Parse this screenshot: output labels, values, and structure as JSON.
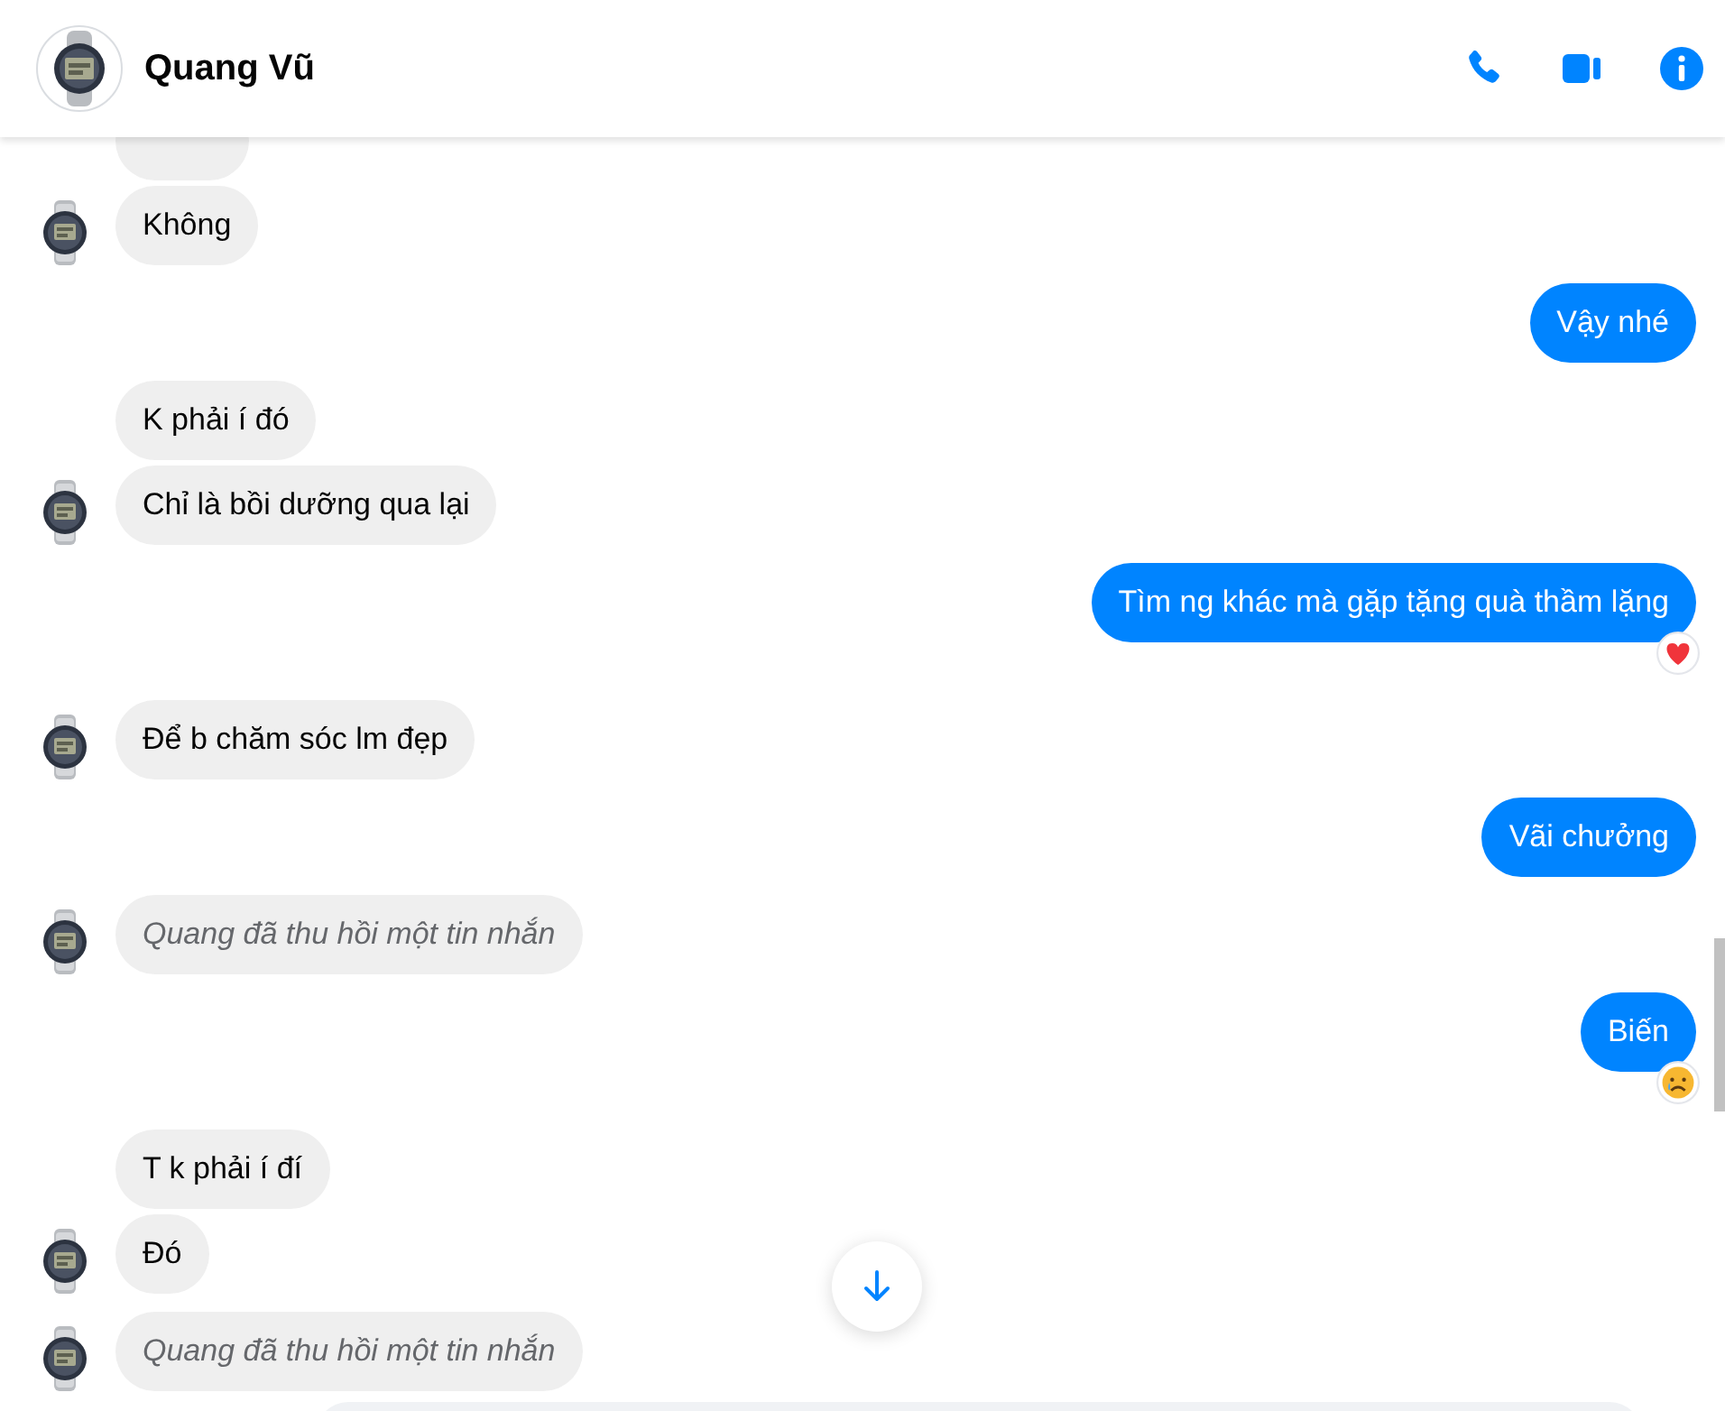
{
  "header": {
    "name": "Quang Vũ"
  },
  "messages": [
    {
      "kind": "incoming",
      "avatar": false
    },
    {
      "kind": "incoming",
      "unsent": false,
      "text": "Không",
      "avatar": true
    },
    {
      "kind": "outgoing",
      "text": "Vậy nhé"
    },
    {
      "kind": "incoming",
      "unsent": false,
      "text": "K phải í đó",
      "avatar": false
    },
    {
      "kind": "incoming",
      "unsent": false,
      "text": "Chỉ là bồi dưỡng qua lại",
      "avatar": true
    },
    {
      "kind": "outgoing",
      "text": "Tìm ng khác mà gặp tặng quà thầm lặng",
      "reaction": {
        "kind": "heart"
      }
    },
    {
      "kind": "incoming",
      "unsent": false,
      "text": "Để b chăm sóc lm đẹp",
      "avatar": true
    },
    {
      "kind": "outgoing",
      "text": "Vãi chưởng"
    },
    {
      "kind": "incoming",
      "unsent": true,
      "text": "Quang đã thu hồi một tin nhắn",
      "avatar": true
    },
    {
      "kind": "outgoing",
      "text": "Biến",
      "reaction": {
        "kind": "sad"
      }
    },
    {
      "kind": "incoming",
      "unsent": false,
      "text": "T k phải í đí",
      "avatar": false
    },
    {
      "kind": "incoming",
      "unsent": false,
      "text": "Đó",
      "avatar": true
    },
    {
      "kind": "incoming",
      "unsent": true,
      "text": "Quang đã thu hồi một tin nhắn",
      "avatar": true
    }
  ]
}
